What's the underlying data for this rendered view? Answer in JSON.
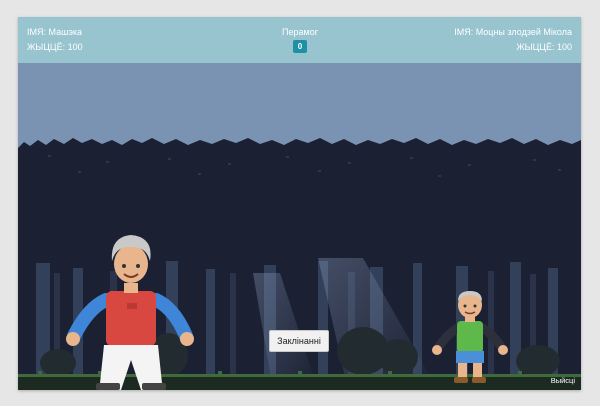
{
  "hud": {
    "player_name": "IМЯ: Машэка",
    "player_health": "ЖЫЦЦЁ: 100",
    "wins_label": "Перамог",
    "wins_count": "0",
    "enemy_name": "IМЯ: Моцны злодзей Мікола",
    "enemy_health": "ЖЫЦЦЁ: 100"
  },
  "controls": {
    "spell_button_label": "Заклінанні",
    "exit_label": "Выйсці"
  },
  "colors": {
    "hud_background": "#97c4cf",
    "wins_badge": "#1f8fa6",
    "sky": "#7b93b3",
    "forest_dark": "#1d2236",
    "player_shirt": "#d94840",
    "player_sleeves": "#3f86d9",
    "enemy_shirt": "#5fb84a",
    "enemy_pants": "#4a90d9"
  }
}
